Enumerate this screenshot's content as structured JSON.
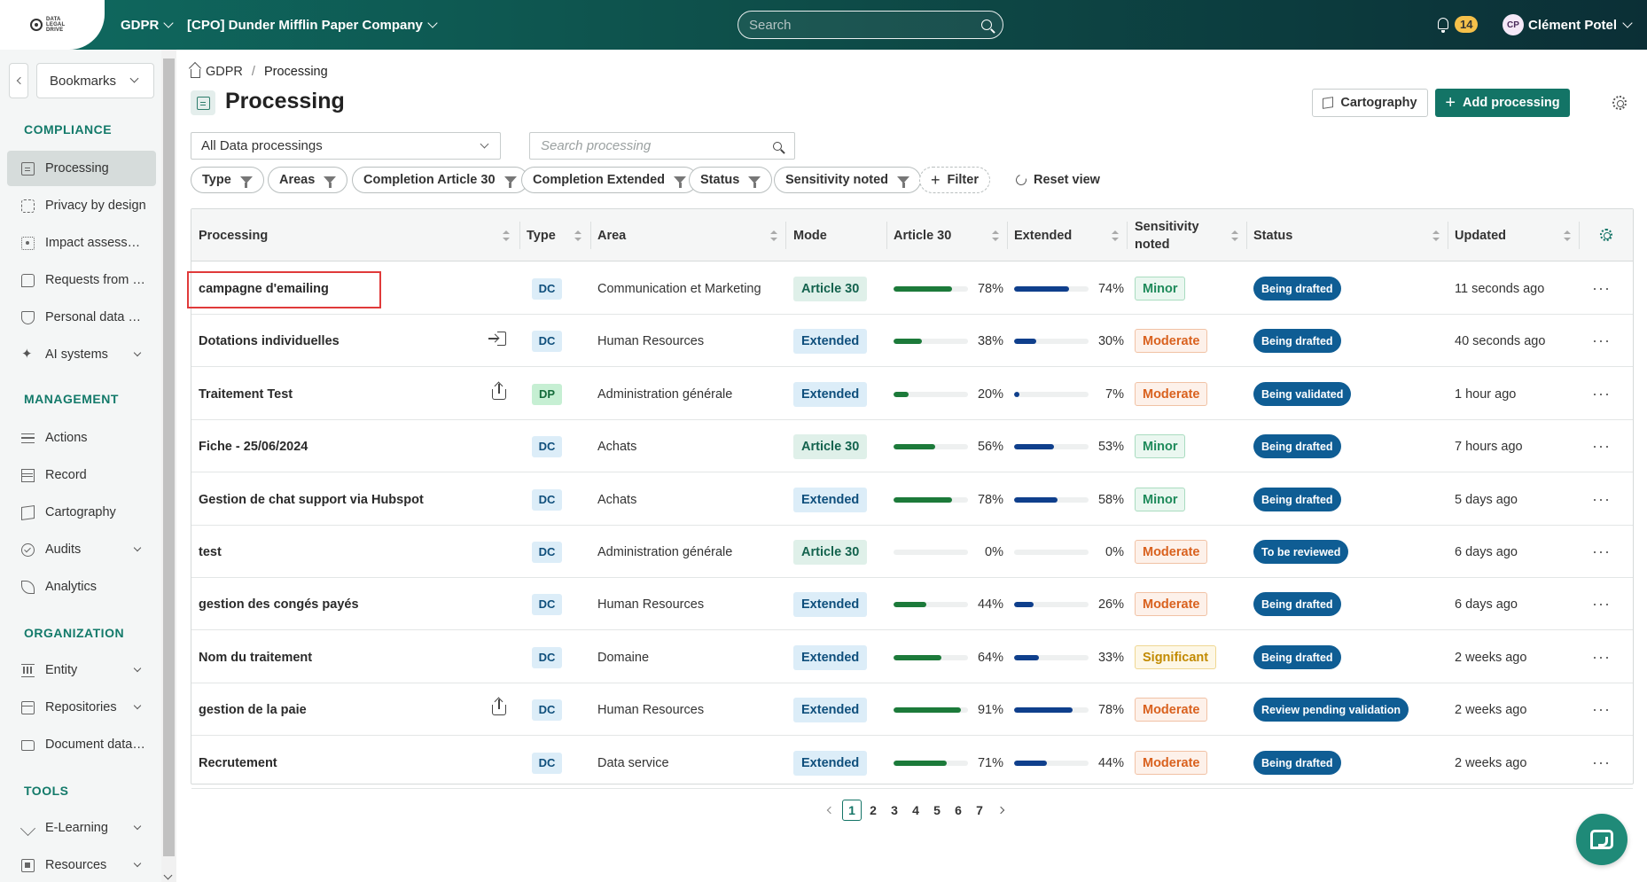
{
  "topbar": {
    "logo_text": "DATA LEGAL DRIVE",
    "module": "GDPR",
    "company": "[CPO] Dunder Mifflin Paper Company",
    "search_placeholder": "Search",
    "notifications": "14",
    "user_initials": "CP",
    "user_name": "Clément Potel"
  },
  "sidebar": {
    "bookmarks": "Bookmarks",
    "sections": {
      "compliance": "COMPLIANCE",
      "management": "MANAGEMENT",
      "organization": "ORGANIZATION",
      "tools": "TOOLS"
    },
    "items": [
      {
        "label": "Processing",
        "icon": "document-icon"
      },
      {
        "label": "Privacy by design",
        "icon": "dashed-square-icon"
      },
      {
        "label": "Impact assessments",
        "icon": "target-icon"
      },
      {
        "label": "Requests from data subjects",
        "icon": "chat-icon"
      },
      {
        "label": "Personal data breaches",
        "icon": "shield-icon"
      },
      {
        "label": "AI systems",
        "icon": "sparkle-icon"
      },
      {
        "label": "Actions",
        "icon": "list-icon"
      },
      {
        "label": "Record",
        "icon": "table-icon"
      },
      {
        "label": "Cartography",
        "icon": "map-icon"
      },
      {
        "label": "Audits",
        "icon": "check-circle-icon"
      },
      {
        "label": "Analytics",
        "icon": "leaf-icon"
      },
      {
        "label": "Entity",
        "icon": "bank-icon"
      },
      {
        "label": "Repositories",
        "icon": "box-icon"
      },
      {
        "label": "Document database",
        "icon": "folder-icon"
      },
      {
        "label": "E-Learning",
        "icon": "graduation-cap-icon"
      },
      {
        "label": "Resources",
        "icon": "resources-icon"
      }
    ]
  },
  "breadcrumb": {
    "root": "GDPR",
    "current": "Processing"
  },
  "page": {
    "title": "Processing",
    "cartography_btn": "Cartography",
    "add_btn": "Add processing",
    "view_select": "All Data processings",
    "search_placeholder": "Search processing",
    "filters": [
      "Type",
      "Areas",
      "Completion Article 30",
      "Completion Extended",
      "Status",
      "Sensitivity noted"
    ],
    "add_filter": "Filter",
    "reset": "Reset view"
  },
  "table": {
    "headers": {
      "processing": "Processing",
      "type": "Type",
      "area": "Area",
      "mode": "Mode",
      "article30": "Article 30",
      "extended": "Extended",
      "sensitivity_1": "Sensitivity",
      "sensitivity_2": "noted",
      "status": "Status",
      "updated": "Updated"
    },
    "rows": [
      {
        "name": "campagne d'emailing",
        "icon": "",
        "type": "DC",
        "area": "Communication et Marketing",
        "mode": "Article 30",
        "a30": 78,
        "ext": 74,
        "sensitivity": "Minor",
        "status": "Being drafted",
        "updated": "11 seconds ago"
      },
      {
        "name": "Dotations individuelles",
        "icon": "login",
        "type": "DC",
        "area": "Human Resources",
        "mode": "Extended",
        "a30": 38,
        "ext": 30,
        "sensitivity": "Moderate",
        "status": "Being drafted",
        "updated": "40 seconds ago"
      },
      {
        "name": "Traitement Test",
        "icon": "share",
        "type": "DP",
        "area": "Administration générale",
        "mode": "Extended",
        "a30": 20,
        "ext": 7,
        "sensitivity": "Moderate",
        "status": "Being validated",
        "updated": "1 hour ago"
      },
      {
        "name": "Fiche - 25/06/2024",
        "icon": "",
        "type": "DC",
        "area": "Achats",
        "mode": "Article 30",
        "a30": 56,
        "ext": 53,
        "sensitivity": "Minor",
        "status": "Being drafted",
        "updated": "7 hours ago"
      },
      {
        "name": "Gestion de chat support via Hubspot",
        "icon": "",
        "type": "DC",
        "area": "Achats",
        "mode": "Extended",
        "a30": 78,
        "ext": 58,
        "sensitivity": "Minor",
        "status": "Being drafted",
        "updated": "5 days ago"
      },
      {
        "name": "test",
        "icon": "",
        "type": "DC",
        "area": "Administration générale",
        "mode": "Article 30",
        "a30": 0,
        "ext": 0,
        "sensitivity": "Moderate",
        "status": "To be reviewed",
        "updated": "6 days ago"
      },
      {
        "name": "gestion des congés payés",
        "icon": "",
        "type": "DC",
        "area": "Human Resources",
        "mode": "Extended",
        "a30": 44,
        "ext": 26,
        "sensitivity": "Moderate",
        "status": "Being drafted",
        "updated": "6 days ago"
      },
      {
        "name": "Nom du traitement",
        "icon": "",
        "type": "DC",
        "area": "Domaine",
        "mode": "Extended",
        "a30": 64,
        "ext": 33,
        "sensitivity": "Significant",
        "status": "Being drafted",
        "updated": "2 weeks ago"
      },
      {
        "name": "gestion de la paie",
        "icon": "share",
        "type": "DC",
        "area": "Human Resources",
        "mode": "Extended",
        "a30": 91,
        "ext": 78,
        "sensitivity": "Moderate",
        "status": "Review pending validation",
        "updated": "2 weeks ago"
      },
      {
        "name": "Recrutement",
        "icon": "",
        "type": "DC",
        "area": "Data service",
        "mode": "Extended",
        "a30": 71,
        "ext": 44,
        "sensitivity": "Moderate",
        "status": "Being drafted",
        "updated": "2 weeks ago"
      }
    ]
  },
  "pagination": {
    "current": "1",
    "pages": [
      "1",
      "2",
      "3",
      "4",
      "5",
      "6",
      "7"
    ]
  },
  "colors": {
    "brand": "#137466",
    "status": "#0f5d94",
    "highlight": "#e03a3a"
  }
}
